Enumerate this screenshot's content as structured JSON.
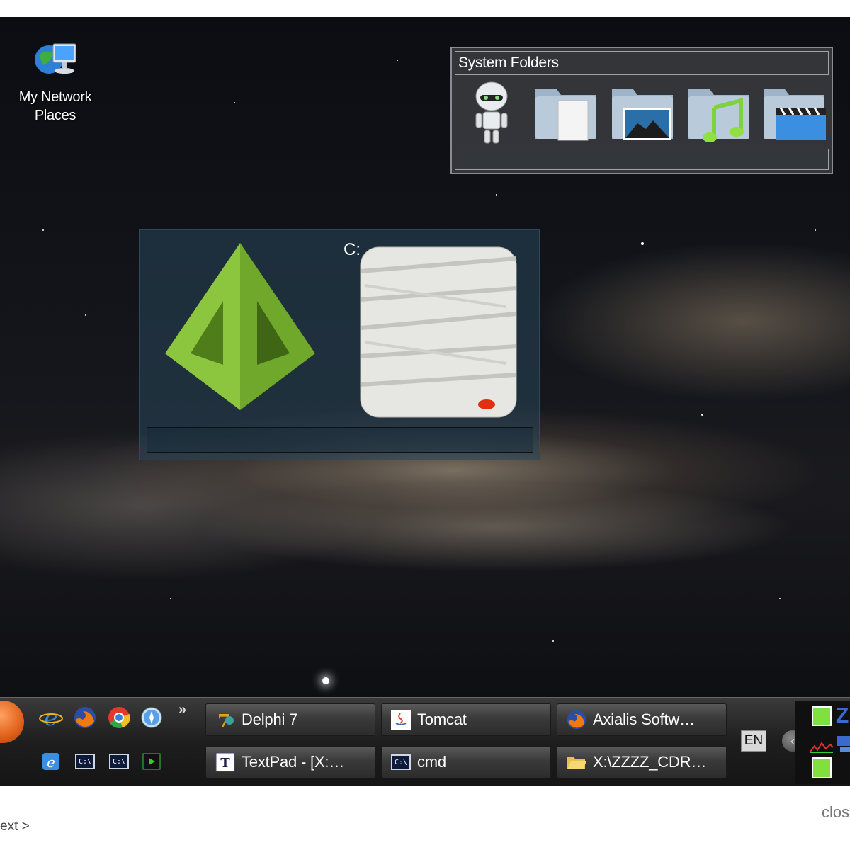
{
  "desktop": {
    "icons": [
      {
        "label_line1": "My Network",
        "label_line2": "Places",
        "icon": "network-places-icon"
      }
    ]
  },
  "system_folders": {
    "title": "System Folders",
    "items": [
      {
        "icon": "robot-user-folder-icon"
      },
      {
        "icon": "documents-folder-icon"
      },
      {
        "icon": "pictures-folder-icon"
      },
      {
        "icon": "music-folder-icon"
      },
      {
        "icon": "videos-folder-icon"
      }
    ]
  },
  "drives_panel": {
    "drive_label": "C:",
    "items": [
      {
        "icon": "green-pyramid-icon"
      },
      {
        "icon": "mummy-drive-icon"
      }
    ]
  },
  "taskbar": {
    "quick_launch_top": [
      {
        "icon": "internet-explorer-icon"
      },
      {
        "icon": "firefox-icon"
      },
      {
        "icon": "chrome-icon"
      },
      {
        "icon": "safari-icon"
      }
    ],
    "quick_launch_bottom": [
      {
        "icon": "ie-settings-icon"
      },
      {
        "icon": "command-prompt-icon",
        "text": "C:\\"
      },
      {
        "icon": "command-prompt-icon",
        "text": "C:\\"
      },
      {
        "icon": "terminal-green-icon"
      }
    ],
    "more": "»",
    "tasks": [
      {
        "label": "Delphi 7",
        "icon": "delphi-icon"
      },
      {
        "label": "Tomcat",
        "icon": "java-icon"
      },
      {
        "label": "Axialis Softw…",
        "icon": "firefox-icon"
      },
      {
        "label": "TextPad - [X:…",
        "icon": "textpad-icon"
      },
      {
        "label": "cmd",
        "icon": "command-prompt-icon",
        "icon_text": "C:\\"
      },
      {
        "label": "X:\\ZZZZ_CDR…",
        "icon": "open-folder-icon"
      }
    ],
    "language": "EN",
    "tray_toggle": "‹"
  },
  "page": {
    "next_link": "ext >",
    "close_link": "clos"
  }
}
